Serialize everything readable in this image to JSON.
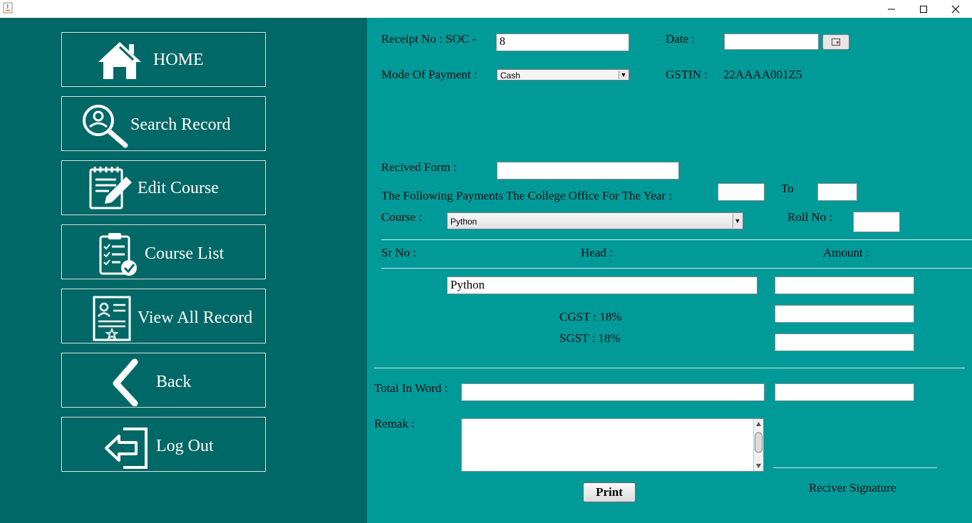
{
  "window": {
    "minimize": "—",
    "maximize": "☐",
    "close": "✕"
  },
  "nav": [
    {
      "label": "HOME",
      "icon": "home-icon"
    },
    {
      "label": "Search Record",
      "icon": "search-user-icon"
    },
    {
      "label": "Edit Course",
      "icon": "edit-document-icon"
    },
    {
      "label": "Course List",
      "icon": "clipboard-check-icon"
    },
    {
      "label": "View All Record",
      "icon": "certificate-icon"
    },
    {
      "label": "Back",
      "icon": "chevron-left-icon"
    },
    {
      "label": "Log Out",
      "icon": "logout-icon"
    }
  ],
  "form": {
    "receipt_label": "Receipt No :  SOC -",
    "receipt_value": "8",
    "date_label": "Date :",
    "date_value": "",
    "mode_label": "Mode Of Payment  :",
    "mode_value": "Cash",
    "gstin_label": "GSTIN :",
    "gstin_value": "22AAAA001Z5",
    "received_from_label": "Recived Form :",
    "received_from_value": "",
    "following_label": "The Following Payments The College Office For The Year :",
    "year_from": "",
    "to_label": "To",
    "year_to": "",
    "course_label": "Course :",
    "course_value": "Python",
    "roll_label": "Roll No :",
    "roll_value": "",
    "sr_label": "Sr No :",
    "head_label": "Head :",
    "amount_label": "Amount :",
    "head_value": "Python",
    "amount_value": "",
    "cgst_label": "CGST : 18%",
    "cgst_value": "",
    "sgst_label": "SGST : 18%",
    "sgst_value": "",
    "total_word_label": "Total In Word :",
    "total_word_value": "",
    "total_value": "",
    "remark_label": "Remak :",
    "remark_value": "",
    "print_label": "Print",
    "signature_label": "Reciver Signature"
  }
}
